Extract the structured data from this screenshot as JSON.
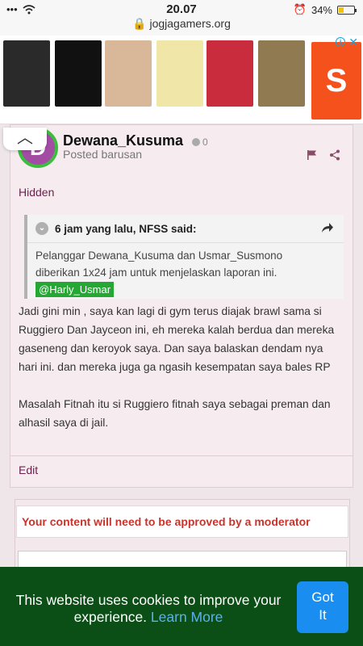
{
  "status_bar": {
    "signal": "•••",
    "wifi": "wifi",
    "time": "20.07",
    "url": "jogjagamers.org",
    "battery_percent": "34%",
    "battery_level": 0.34
  },
  "ad": {
    "brand": "S",
    "tile_colors": [
      "#2a2a2a",
      "#111111",
      "#d9b89a",
      "#f0e6a8",
      "#c92c3c",
      "#8f7a52"
    ]
  },
  "post": {
    "avatar_letter": "D",
    "username": "Dewana_Kusuma",
    "post_count": "0",
    "posted": "Posted barusan",
    "hidden_label": "Hidden",
    "quote": {
      "header": "6 jam yang lalu, NFSS said:",
      "text": "Pelanggar Dewana_Kusuma dan Usmar_Susmono diberikan 1x24 jam untuk menjelaskan laporan ini.",
      "mention": "@Harly_Usmar"
    },
    "paragraphs": [
      "Jadi gini min , saya kan lagi di gym terus diajak brawl sama si Ruggiero Dan Jayceon ini, eh mereka kalah berdua dan mereka gaseneng dan keroyok saya. Dan saya balaskan dendam nya hari ini. dan mereka juga ga ngasih kesempatan saya bales RP",
      "Masalah Fitnah itu si Ruggiero fitnah saya sebagai preman dan alhasil saya di jail."
    ],
    "edit_label": "Edit"
  },
  "moderation": {
    "notice": "Your content will need to be approved by a moderator"
  },
  "cookie": {
    "text": "This website uses cookies to improve your experience.",
    "learn_more": "Learn More",
    "button": "Got It"
  },
  "colors": {
    "accent": "#6b1f4c",
    "cookie_bg": "#0b4f16",
    "button_blue": "#1a8ef0",
    "warning": "#c8342c"
  }
}
